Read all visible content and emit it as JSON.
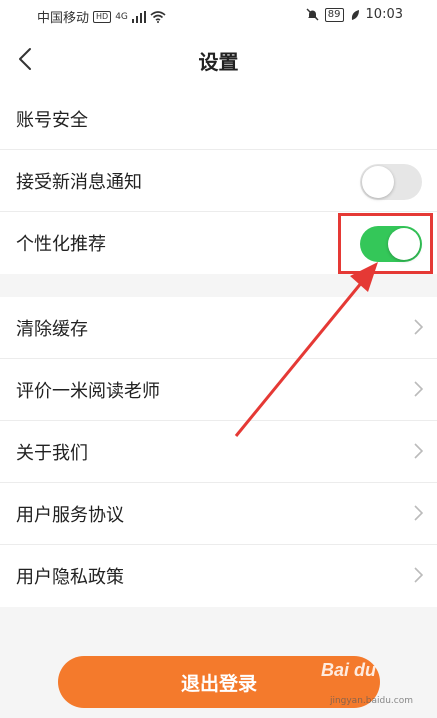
{
  "status_bar": {
    "carrier": "中国移动",
    "hd": "HD",
    "network": "4G",
    "battery": "89",
    "time": "10:03"
  },
  "nav": {
    "title": "设置"
  },
  "group1": [
    {
      "label": "账号安全",
      "type": "link"
    },
    {
      "label": "接受新消息通知",
      "type": "toggle",
      "enabled": false
    },
    {
      "label": "个性化推荐",
      "type": "toggle",
      "enabled": true
    }
  ],
  "group2": [
    {
      "label": "清除缓存"
    },
    {
      "label": "评价一米阅读老师"
    },
    {
      "label": "关于我们"
    },
    {
      "label": "用户服务协议"
    },
    {
      "label": "用户隐私政策"
    }
  ],
  "logout_label": "退出登录",
  "watermark": {
    "brand": "Bai du",
    "site": "jingyan.baidu.com"
  },
  "colors": {
    "accent_orange": "#f47a2c",
    "toggle_on": "#34c759",
    "annotation_red": "#e53935"
  }
}
